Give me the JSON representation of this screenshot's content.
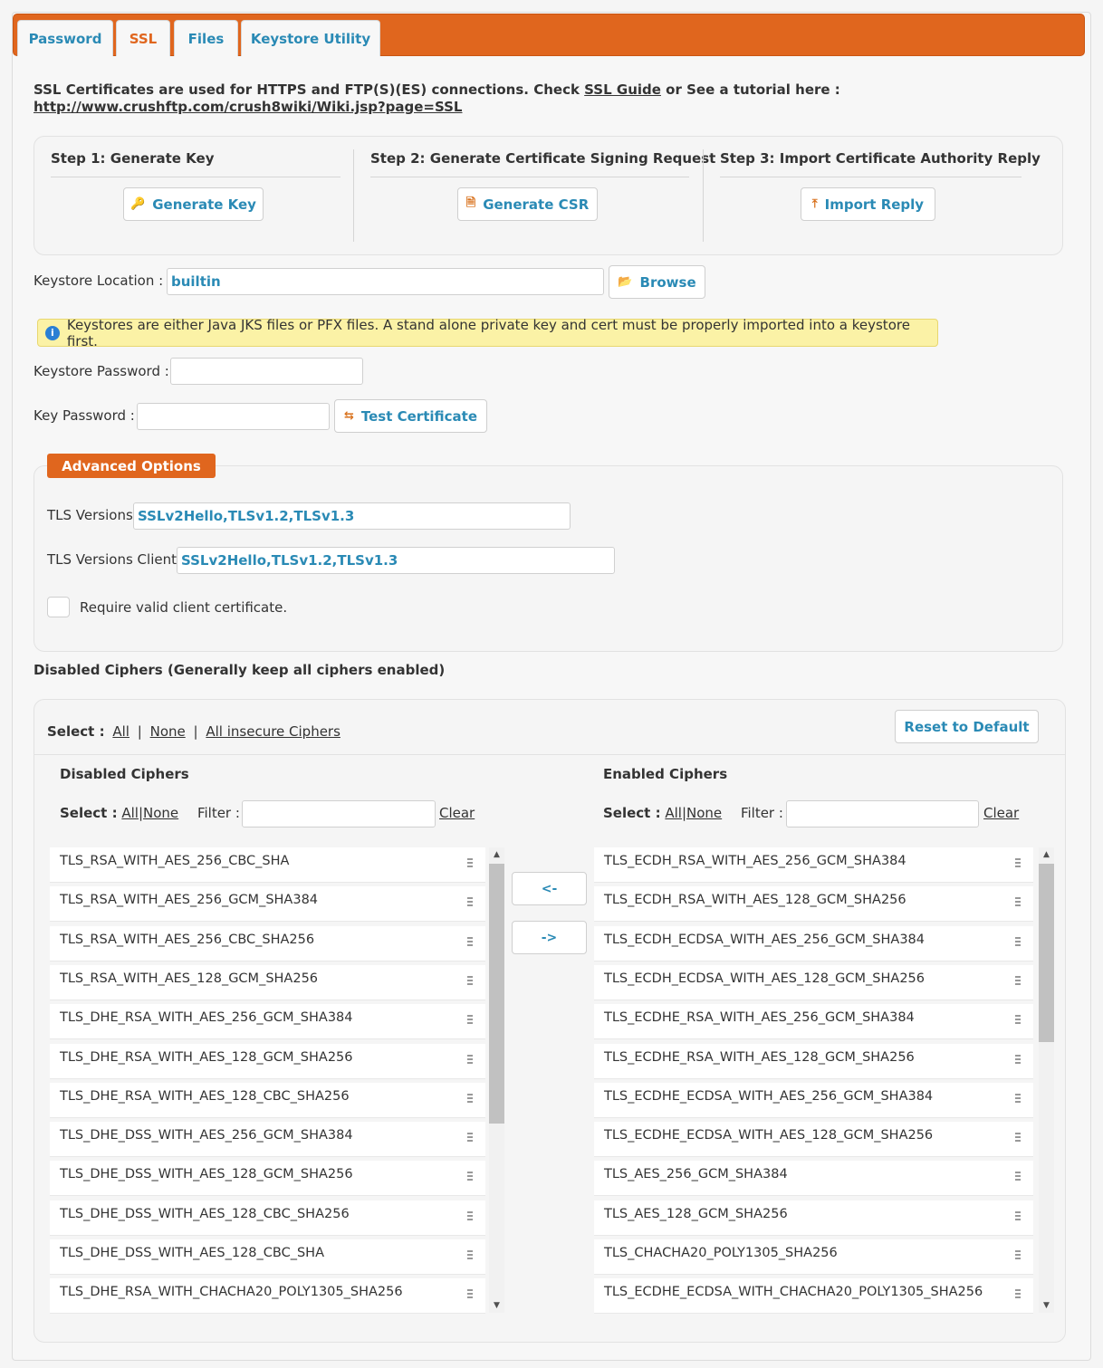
{
  "tabs": [
    {
      "label": "Password",
      "active": false
    },
    {
      "label": "SSL",
      "active": true
    },
    {
      "label": "Files",
      "active": false
    },
    {
      "label": "Keystore Utility",
      "active": false
    }
  ],
  "intro": {
    "text": "SSL Certificates are used for HTTPS and FTP(S)(ES) connections. Check",
    "guide_link": "SSL Guide",
    "text2": "or See a tutorial here :",
    "tutorial_url": "http://www.crushftp.com/crush8wiki/Wiki.jsp?page=SSL"
  },
  "steps": [
    {
      "title": "Step 1: Generate Key",
      "button": "Generate Key",
      "icon": "key-icon"
    },
    {
      "title": "Step 2: Generate Certificate Signing Request",
      "button": "Generate CSR",
      "icon": "document-icon"
    },
    {
      "title": "Step 3: Import Certificate Authority Reply",
      "button": "Import Reply",
      "icon": "upload-icon"
    }
  ],
  "keystore": {
    "location_label": "Keystore Location :",
    "location_value": "builtin",
    "browse_label": "Browse",
    "notice": "Keystores are either Java JKS files or PFX files. A stand alone private key and cert must be properly imported into a keystore first.",
    "password_label": "Keystore Password :",
    "password_value": "",
    "key_password_label": "Key Password :",
    "key_password_value": "",
    "test_button": "Test Certificate"
  },
  "advanced": {
    "title": "Advanced Options",
    "tls_label": "TLS Versions",
    "tls_value": "SSLv2Hello,TLSv1.2,TLSv1.3",
    "tls_client_label": "TLS Versions Client",
    "tls_client_value": "SSLv2Hello,TLSv1.2,TLSv1.3",
    "require_cert_label": "Require valid client certificate."
  },
  "ciphers": {
    "section_title": "Disabled Ciphers (Generally keep all ciphers enabled)",
    "select_label": "Select :",
    "select_all": "All",
    "select_none": "None",
    "select_insecure": "All insecure Ciphers",
    "reset_button": "Reset to Default",
    "disabled_title": "Disabled Ciphers",
    "enabled_title": "Enabled Ciphers",
    "list_select_label": "Select :",
    "list_all": "All",
    "list_none": "None",
    "filter_label": "Filter :",
    "clear_label": "Clear",
    "move_left": "<-",
    "move_right": "->",
    "disabled_list": [
      "TLS_RSA_WITH_AES_256_CBC_SHA",
      "TLS_RSA_WITH_AES_256_GCM_SHA384",
      "TLS_RSA_WITH_AES_256_CBC_SHA256",
      "TLS_RSA_WITH_AES_128_GCM_SHA256",
      "TLS_DHE_RSA_WITH_AES_256_GCM_SHA384",
      "TLS_DHE_RSA_WITH_AES_128_GCM_SHA256",
      "TLS_DHE_RSA_WITH_AES_128_CBC_SHA256",
      "TLS_DHE_DSS_WITH_AES_256_GCM_SHA384",
      "TLS_DHE_DSS_WITH_AES_128_GCM_SHA256",
      "TLS_DHE_DSS_WITH_AES_128_CBC_SHA256",
      "TLS_DHE_DSS_WITH_AES_128_CBC_SHA",
      "TLS_DHE_RSA_WITH_CHACHA20_POLY1305_SHA256"
    ],
    "enabled_list": [
      "TLS_ECDH_RSA_WITH_AES_256_GCM_SHA384",
      "TLS_ECDH_RSA_WITH_AES_128_GCM_SHA256",
      "TLS_ECDH_ECDSA_WITH_AES_256_GCM_SHA384",
      "TLS_ECDH_ECDSA_WITH_AES_128_GCM_SHA256",
      "TLS_ECDHE_RSA_WITH_AES_256_GCM_SHA384",
      "TLS_ECDHE_RSA_WITH_AES_128_GCM_SHA256",
      "TLS_ECDHE_ECDSA_WITH_AES_256_GCM_SHA384",
      "TLS_ECDHE_ECDSA_WITH_AES_128_GCM_SHA256",
      "TLS_AES_256_GCM_SHA384",
      "TLS_AES_128_GCM_SHA256",
      "TLS_CHACHA20_POLY1305_SHA256",
      "TLS_ECDHE_ECDSA_WITH_CHACHA20_POLY1305_SHA256"
    ]
  },
  "colors": {
    "accent": "#e0661e",
    "link": "#2a8ab5",
    "notice_bg": "#fbf2a6"
  }
}
